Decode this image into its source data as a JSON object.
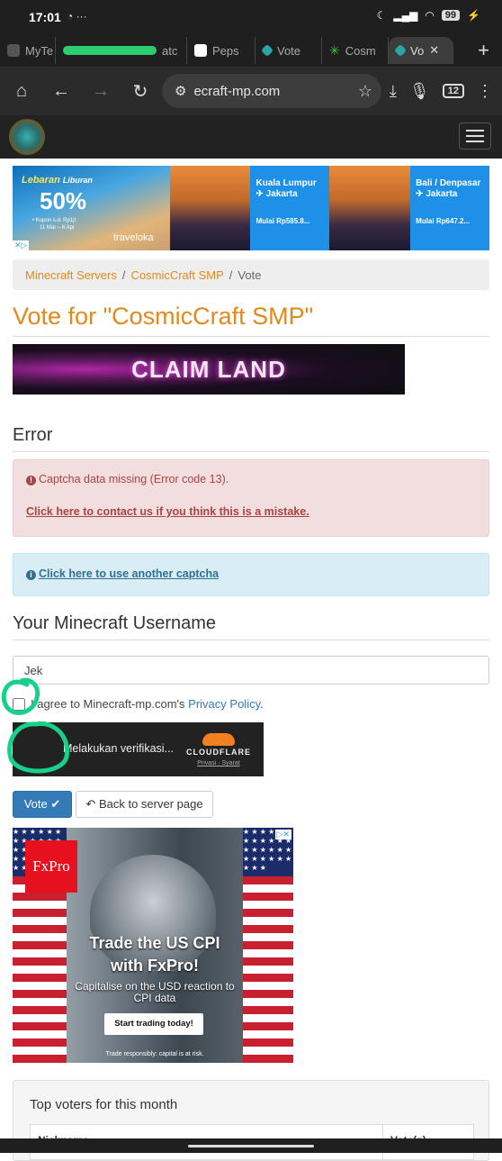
{
  "status_bar": {
    "time": "17:01",
    "battery": "99"
  },
  "browser": {
    "tabs": [
      {
        "label": "MyTe",
        "favicon_color": "#555555"
      },
      {
        "label": "atc",
        "favicon_color": "#2ecc71"
      },
      {
        "label": "Peps",
        "favicon_color": "#ffffff"
      },
      {
        "label": "Vote",
        "favicon_color": "#2aa6a6"
      },
      {
        "label": "Cosm",
        "favicon_color": "#3fbf3f"
      },
      {
        "label": "Vo",
        "favicon_color": "#2aa6a6"
      }
    ],
    "url": "ecraft-mp.com",
    "tab_count": "12"
  },
  "ad_banner": {
    "promo_title": "Lebaran",
    "promo_subtitle": "Liburan",
    "promo_percent": "50%",
    "promo_coupon": "• Kupon s.d. Rp1jt",
    "promo_dates": "11 Mar – 6 Apr",
    "brand": "traveloka",
    "offers": [
      {
        "route": "Kuala Lumpur ✈ Jakarta",
        "price": "Mulai Rp585.8..."
      },
      {
        "route": "Bali / Denpasar ✈ Jakarta",
        "price": "Mulai Rp647.2..."
      }
    ]
  },
  "breadcrumb": {
    "item1": "Minecraft Servers",
    "item2": "CosmicCraft SMP",
    "current": "Vote",
    "sep": "/"
  },
  "page_title": "Vote for \"CosmicCraft SMP\"",
  "server_banner_text": "CLAIM LAND",
  "error_section": {
    "heading": "Error",
    "message": "Captcha data missing (Error code 13).",
    "contact_link": "Click here to contact us if you think this is a mistake."
  },
  "captcha_info_link": "Click here to use another captcha",
  "username_section": {
    "heading": "Your Minecraft Username",
    "value": "Jek"
  },
  "agree": {
    "text": "I agree to Minecraft-mp.com's",
    "link": "Privacy Policy",
    "suffix": "."
  },
  "turnstile": {
    "text": "Melakukan verifikasi...",
    "brand": "CLOUDFLARE",
    "privacy": "Privasi",
    "terms": "Syarat"
  },
  "buttons": {
    "vote": "Vote",
    "back": "Back to server page"
  },
  "fx_ad": {
    "logo": "FxPro",
    "headline1": "Trade the US CPI",
    "headline2": "with FxPro!",
    "sub": "Capitalise on the USD reaction to CPI data",
    "cta": "Start trading today!",
    "legal": "Trade responsibly: capital is at risk."
  },
  "top_voters": {
    "title": "Top voters for this month",
    "col1": "Nickname",
    "col2": "Vote(s)"
  },
  "colors": {
    "accent": "#e08a1e",
    "primary": "#337ab7",
    "danger_bg": "#f2dede",
    "info_bg": "#d9edf7"
  }
}
